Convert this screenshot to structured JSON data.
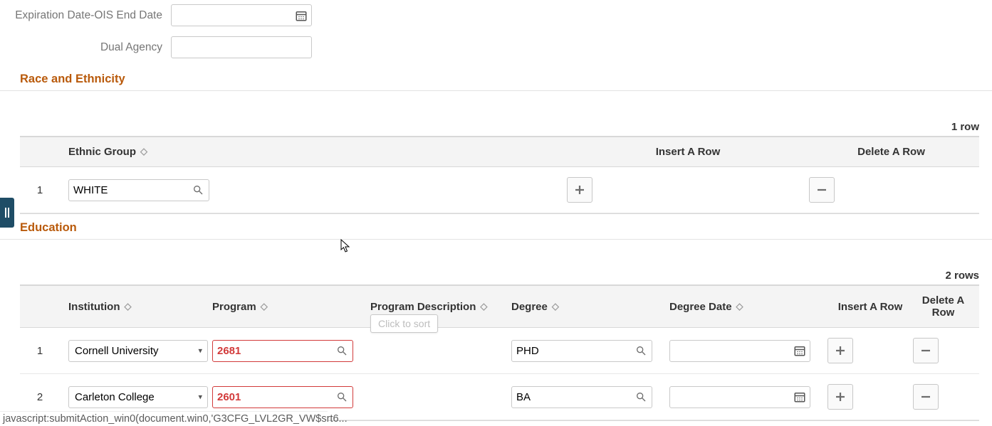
{
  "form": {
    "expiration_label": "Expiration Date-OIS End Date",
    "expiration_value": "",
    "dual_agency_label": "Dual Agency",
    "dual_agency_value": ""
  },
  "race": {
    "heading": "Race and Ethnicity",
    "row_count_label": "1 row",
    "columns": {
      "ethnic_group": "Ethnic Group",
      "insert": "Insert A Row",
      "delete": "Delete A Row"
    },
    "rows": [
      {
        "num": "1",
        "ethnic_group": "WHITE"
      }
    ]
  },
  "education": {
    "heading": "Education",
    "row_count_label": "2 rows",
    "columns": {
      "institution": "Institution",
      "program": "Program",
      "program_desc": "Program Description",
      "degree": "Degree",
      "degree_date": "Degree Date",
      "insert": "Insert A Row",
      "delete": "Delete A Row"
    },
    "rows": [
      {
        "num": "1",
        "institution": "Cornell University",
        "program": "2681",
        "program_desc": "",
        "degree": "PHD",
        "degree_date": ""
      },
      {
        "num": "2",
        "institution": "Carleton College",
        "program": "2601",
        "program_desc": "",
        "degree": "BA",
        "degree_date": ""
      }
    ]
  },
  "tooltip": {
    "text": "Click to sort"
  },
  "status": {
    "text": "javascript:submitAction_win0(document.win0,'G3CFG_LVL2GR_VW$srt6..."
  }
}
